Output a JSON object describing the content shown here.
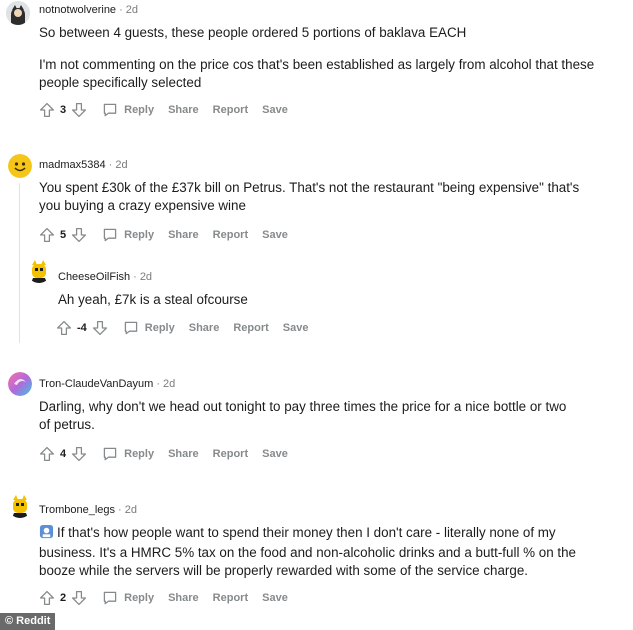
{
  "actions": {
    "reply": "Reply",
    "share": "Share",
    "report": "Report",
    "save": "Save"
  },
  "comments": [
    {
      "username": "notnotwolverine",
      "time": "2d",
      "paragraphs": [
        "So between 4 guests, these people ordered 5 portions of baklava EACH",
        "I'm not commenting on the price cos that's been established as largely from alcohol that these people specifically selected"
      ],
      "score": "3",
      "avatar_icon": "dark-character-avatar"
    },
    {
      "username": "madmax5384",
      "time": "2d",
      "paragraphs": [
        "You spent £30k of the £37k bill on Petrus. That's not the restaurant \"being expensive\" that's you buying a crazy expensive wine"
      ],
      "score": "5",
      "avatar_icon": "yellow-smiley-avatar"
    },
    {
      "username": "CheeseOilFish",
      "time": "2d",
      "paragraphs": [
        "Ah yeah, £7k is a steal ofcourse"
      ],
      "score": "-4",
      "avatar_icon": "yellow-character-avatar"
    },
    {
      "username": "Tron-ClaudeVanDayum",
      "time": "2d",
      "paragraphs": [
        "Darling, why don't we head out tonight to pay three times the price for a nice bottle or two of petrus."
      ],
      "score": "4",
      "avatar_icon": "pink-swirl-avatar"
    },
    {
      "username": "Trombone_legs",
      "time": "2d",
      "paragraphs": [
        "If that's how people want to spend their money then I don't care - literally none of my business. It's a HMRC 5% tax on the food and non-alcoholic drinks and a butt-full % on the booze while the servers will be properly rewarded with some of the service charge."
      ],
      "score": "2",
      "avatar_icon": "yellow-character-avatar"
    }
  ],
  "watermark": "© Reddit"
}
